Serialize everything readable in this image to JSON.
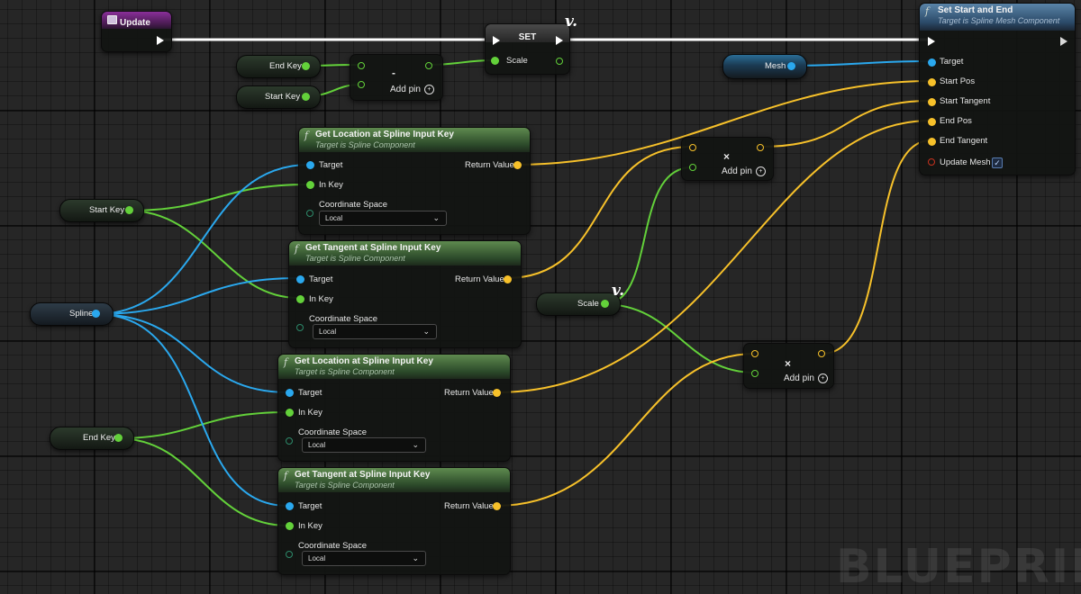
{
  "watermark": "BLUEPRINT",
  "event": {
    "title": "Update"
  },
  "set_node": {
    "title": "SET",
    "pin": "Scale"
  },
  "subtract_node": {
    "op": "-",
    "add_pin": "Add pin"
  },
  "multiply_node_1": {
    "op": "×",
    "add_pin": "Add pin"
  },
  "multiply_node_2": {
    "op": "×",
    "add_pin": "Add pin"
  },
  "variables": {
    "end_key_top": "End Key",
    "start_key_top": "Start Key",
    "start_key": "Start Key",
    "spline": "Spline",
    "end_key": "End Key",
    "scale": "Scale",
    "mesh": "Mesh"
  },
  "set_start_end": {
    "title": "Set Start and End",
    "subtitle": "Target is Spline Mesh Component",
    "pins": [
      "Target",
      "Start Pos",
      "Start Tangent",
      "End Pos",
      "End Tangent",
      "Update Mesh"
    ]
  },
  "nodes": [
    {
      "title": "Get Location at Spline Input Key",
      "subtitle": "Target is Spline Component",
      "target": "Target",
      "in_key": "In Key",
      "return": "Return Value",
      "coord": "Coordinate Space",
      "coord_value": "Local"
    },
    {
      "title": "Get Tangent at Spline Input Key",
      "subtitle": "Target is Spline Component",
      "target": "Target",
      "in_key": "In Key",
      "return": "Return Value",
      "coord": "Coordinate Space",
      "coord_value": "Local"
    },
    {
      "title": "Get Location at Spline Input Key",
      "subtitle": "Target is Spline Component",
      "target": "Target",
      "in_key": "In Key",
      "return": "Return Value",
      "coord": "Coordinate Space",
      "coord_value": "Local"
    },
    {
      "title": "Get Tangent at Spline Input Key",
      "subtitle": "Target is Spline Component",
      "target": "Target",
      "in_key": "In Key",
      "return": "Return Value",
      "coord": "Coordinate Space",
      "coord_value": "Local"
    }
  ],
  "colors": {
    "exec": "#ffffff",
    "object": "#2aa8ee",
    "float": "#63d13a",
    "vector": "#f7c12a",
    "bool": "#c8321e"
  }
}
